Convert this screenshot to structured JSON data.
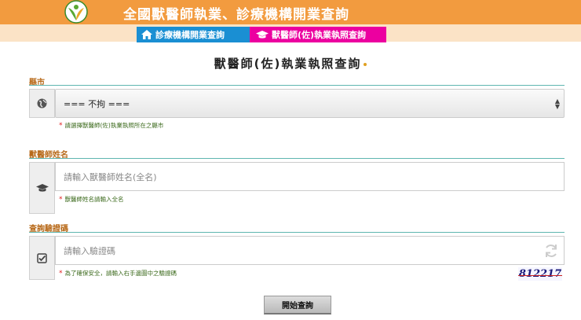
{
  "header": {
    "site_title": "全國獸醫師執業、診療機構開業查詢"
  },
  "tabs": [
    {
      "label": "診療機構開業查詢",
      "icon": "home-icon",
      "color": "#1a8fd3"
    },
    {
      "label": "獸醫師(佐)執業執照查詢",
      "icon": "graduation-cap-icon",
      "color": "#ec00a0"
    }
  ],
  "form": {
    "title": "獸醫師(佐)執業執照查詢",
    "county": {
      "label": "縣市",
      "selected": "=== 不拘 ===",
      "hint": "請選擇獸醫師(佐)執業執照所在之縣市",
      "icon": "globe-icon"
    },
    "name": {
      "label": "獸醫師姓名",
      "placeholder": "請輸入獸醫師姓名(全名)",
      "hint": "獸醫師姓名請輸入全名",
      "icon": "graduation-cap-icon"
    },
    "captcha": {
      "label": "查詢驗證碼",
      "placeholder": "請輸入驗證碼",
      "hint": "為了確保安全，請輸入右手邊圖中之驗證碼",
      "code": "812217",
      "icon": "checkbox-icon"
    },
    "submit_label": "開始查詢",
    "required_mark": "*"
  },
  "colors": {
    "header_bg": "#f29b3f",
    "section_label": "#b86a1a",
    "section_line": "#5fb6b0",
    "hint_text": "#3d6b1e"
  }
}
